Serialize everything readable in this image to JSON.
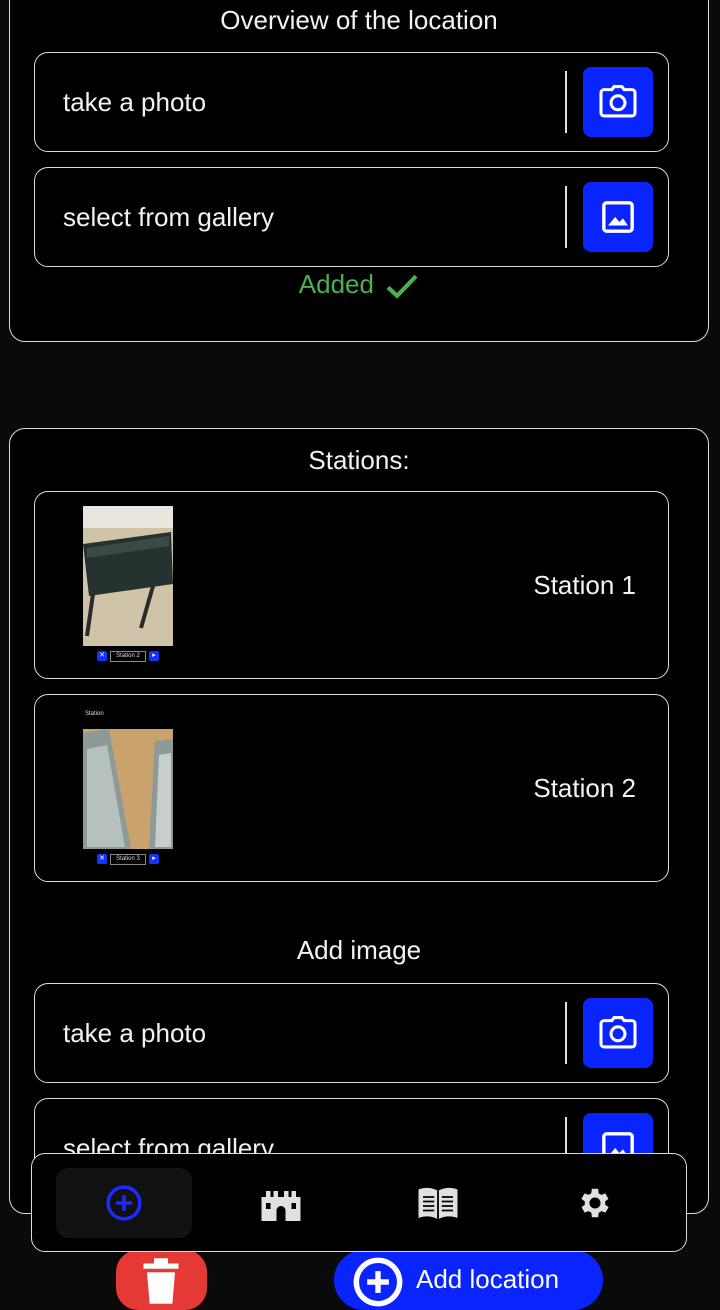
{
  "overview": {
    "title": "Overview of the location",
    "take_photo": "take a photo",
    "select_gallery": "select from gallery",
    "status": "Added"
  },
  "stations": {
    "title": "Stations:",
    "items": [
      {
        "name": "Station 1",
        "thumb_field": "Station 2"
      },
      {
        "name": "Station 2",
        "thumb_field": "Station 3",
        "thumb_header": "Station"
      }
    ]
  },
  "add_image": {
    "title": "Add image",
    "take_photo": "take a photo",
    "select_gallery": "select from gallery"
  },
  "bottom_nav": {
    "items": [
      {
        "icon": "add-circle-icon",
        "active": true
      },
      {
        "icon": "castle-icon",
        "active": false
      },
      {
        "icon": "book-icon",
        "active": false
      },
      {
        "icon": "gear-icon",
        "active": false
      }
    ]
  },
  "fabs": {
    "add_label": "Add location"
  },
  "colors": {
    "accent": "#0a24ff",
    "success": "#4caf50",
    "danger": "#e53935"
  }
}
